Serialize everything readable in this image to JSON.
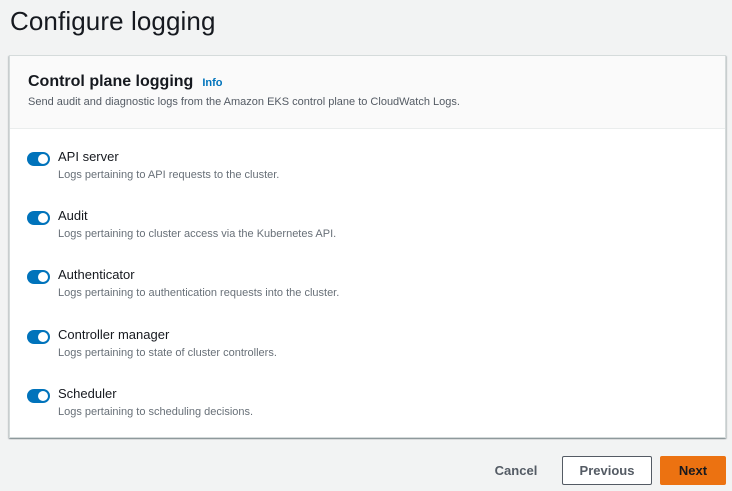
{
  "page": {
    "title": "Configure logging"
  },
  "panel": {
    "title": "Control plane logging",
    "info_label": "Info",
    "description": "Send audit and diagnostic logs from the Amazon EKS control plane to CloudWatch Logs."
  },
  "toggles": [
    {
      "label": "API server",
      "description": "Logs pertaining to API requests to the cluster.",
      "enabled": true
    },
    {
      "label": "Audit",
      "description": "Logs pertaining to cluster access via the Kubernetes API.",
      "enabled": true
    },
    {
      "label": "Authenticator",
      "description": "Logs pertaining to authentication requests into the cluster.",
      "enabled": true
    },
    {
      "label": "Controller manager",
      "description": "Logs pertaining to state of cluster controllers.",
      "enabled": true
    },
    {
      "label": "Scheduler",
      "description": "Logs pertaining to scheduling decisions.",
      "enabled": true
    }
  ],
  "footer": {
    "cancel_label": "Cancel",
    "previous_label": "Previous",
    "next_label": "Next"
  },
  "colors": {
    "accent": "#0073bb",
    "primary_button": "#ec7211",
    "background": "#f2f3f3"
  }
}
